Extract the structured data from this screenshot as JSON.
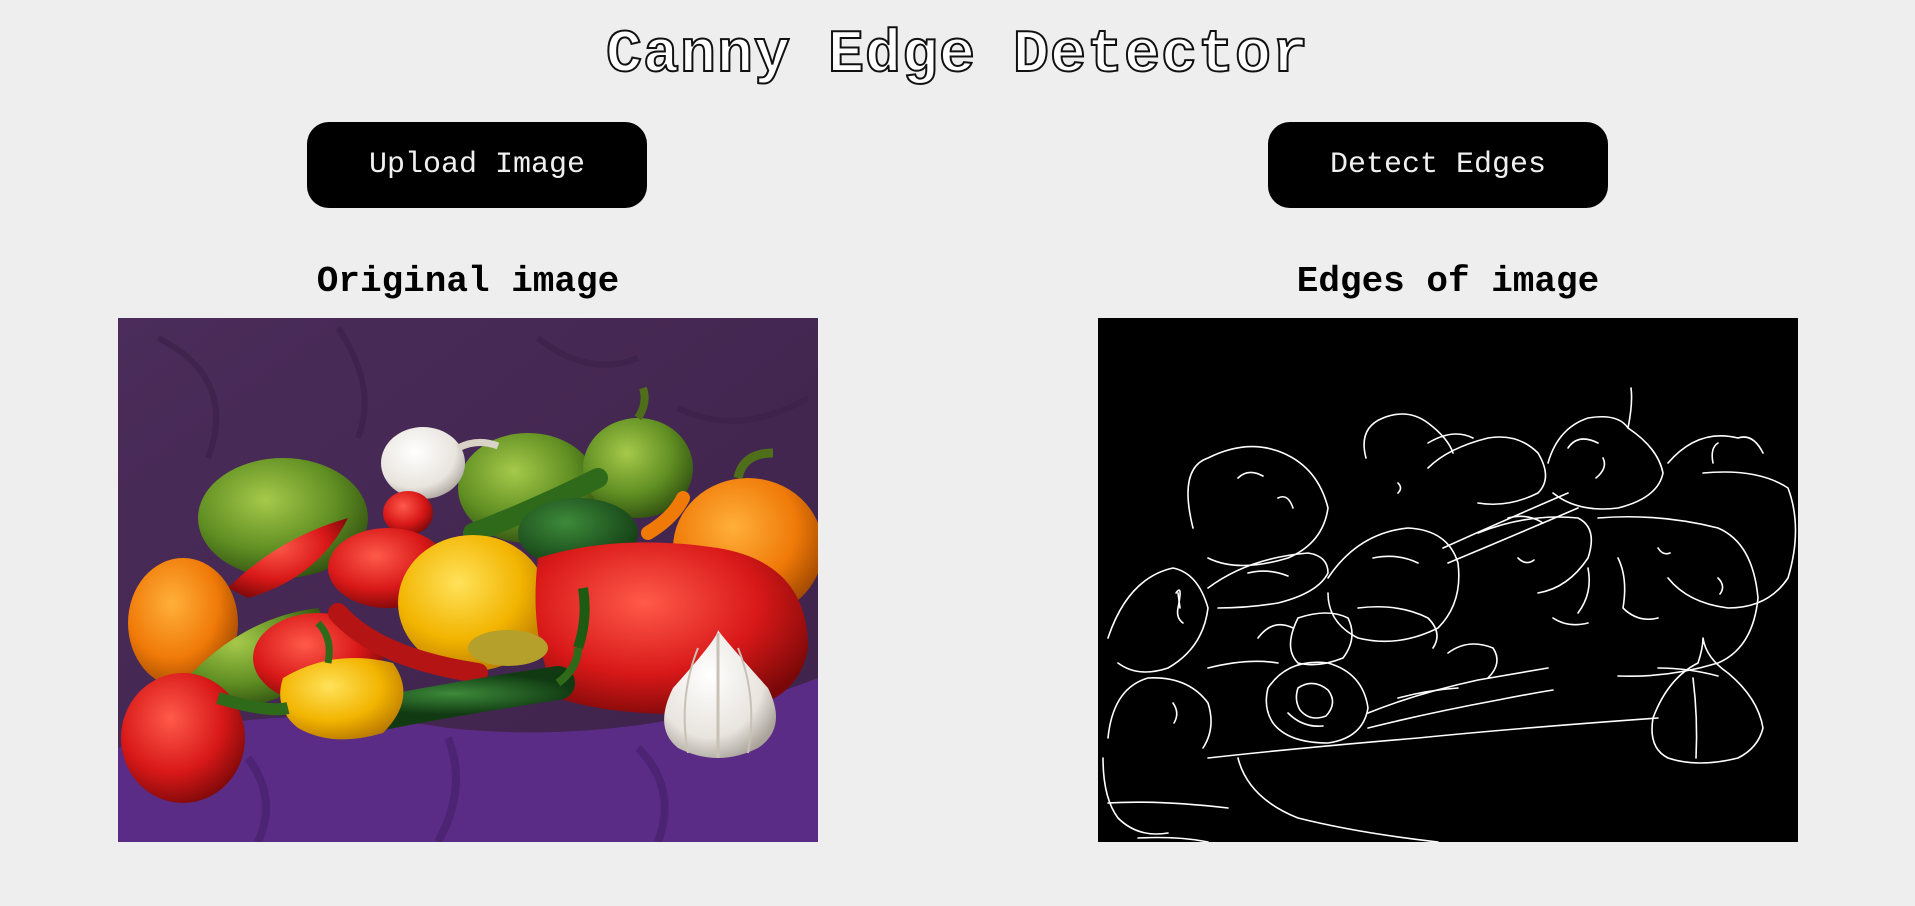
{
  "header": {
    "title": "Canny Edge Detector"
  },
  "toolbar": {
    "upload_label": "Upload Image",
    "detect_label": "Detect Edges"
  },
  "panels": {
    "original": {
      "title": "Original image"
    },
    "edges": {
      "title": "Edges of image"
    }
  },
  "colors": {
    "background": "#eeeeee",
    "button": "#000000",
    "button_text": "#f0f0f0",
    "edge_line": "#ffffff",
    "backdrop_purple": "#4a2d5c",
    "cloth_purple": "#5b2c86"
  }
}
